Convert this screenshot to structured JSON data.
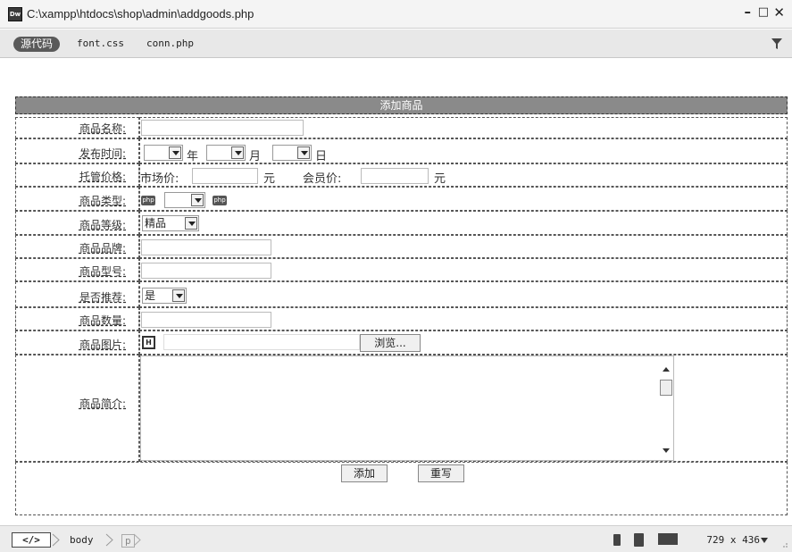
{
  "window": {
    "title": "C:\\xampp\\htdocs\\shop\\admin\\addgoods.php",
    "app_icon": "Dw",
    "minimize": "–",
    "maximize": "□",
    "close": "✕"
  },
  "toolbar": {
    "source_button": "源代码",
    "files": [
      "font.css",
      "conn.php"
    ]
  },
  "form": {
    "header": "添加商品",
    "labels": {
      "name": "商品名称:",
      "publish_time": "发布时间:",
      "price": "托管价格:",
      "category": "商品类型:",
      "grade": "商品等级:",
      "brand": "商品品牌:",
      "model": "商品型号:",
      "recommend": "是否推荐:",
      "quantity": "商品数量:",
      "image": "商品图片:",
      "intro": "商品简介:"
    },
    "date_units": {
      "year": "年",
      "month": "月",
      "day": "日"
    },
    "price_texts": {
      "market": "市场价:",
      "member": "会员价:",
      "unit": "元"
    },
    "php_tag": "php",
    "grade_value": "精品",
    "recommend_value": "是",
    "file_icon": "H",
    "browse_button": "浏览...",
    "submit_button": "添加",
    "reset_button": "重写"
  },
  "statusbar": {
    "code_tag": "</>",
    "crumbs": [
      "body",
      "p"
    ],
    "size": "729 x 436"
  },
  "icons": [
    "dw-app-icon",
    "filter-icon",
    "mobile-icon",
    "tablet-icon",
    "desktop-icon",
    "chevron-down-icon",
    "resize-grip-icon"
  ]
}
